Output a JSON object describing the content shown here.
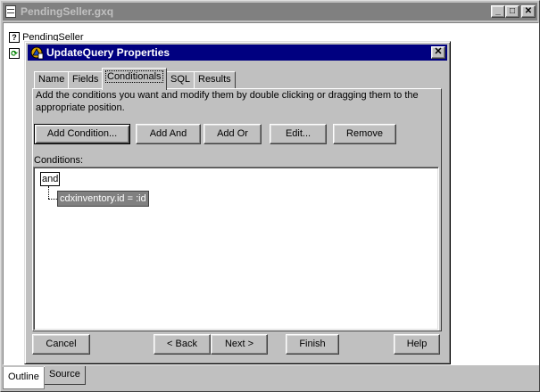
{
  "outer_window": {
    "title": "PendingSeller.gxq",
    "tree_items": [
      {
        "icon": "?",
        "label": "PendingSeller"
      },
      {
        "icon": "⟳",
        "label": ""
      }
    ],
    "bottom_tabs": [
      "Outline",
      "Source"
    ],
    "active_bottom_tab": "Outline"
  },
  "dialog": {
    "title": "UpdateQuery Properties",
    "tabs": [
      {
        "label": "Name"
      },
      {
        "label": "Fields"
      },
      {
        "label": "Conditionals"
      },
      {
        "label": "SQL"
      },
      {
        "label": "Results"
      }
    ],
    "active_tab": "Conditionals",
    "instructions": "Add the conditions you want and modify them by double clicking or dragging them to the appropriate position.",
    "buttons": {
      "add_condition": "Add Condition...",
      "add_and": "Add And",
      "add_or": "Add Or",
      "edit": "Edit...",
      "remove": "Remove"
    },
    "conditions_label": "Conditions:",
    "conditions": {
      "root": "and",
      "children": [
        "cdxinventory.id = :id"
      ]
    },
    "footer": {
      "cancel": "Cancel",
      "back": "< Back",
      "next": "Next >",
      "finish": "Finish",
      "help": "Help"
    }
  },
  "colors": {
    "active_title": "#000080",
    "inactive_title": "#808080",
    "face": "#c0c0c0",
    "selection": "#808080"
  }
}
